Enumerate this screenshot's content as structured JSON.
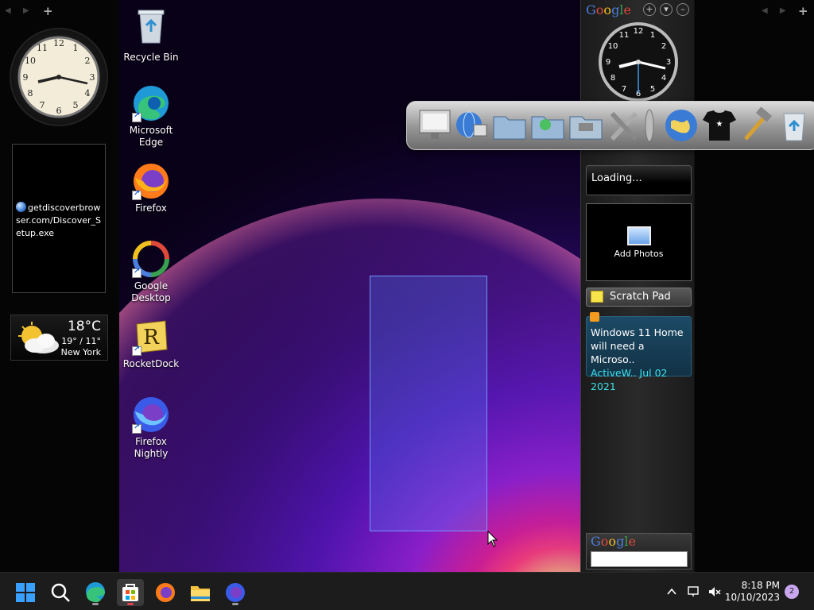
{
  "left_sidebar": {
    "nav_arrows": "◀ ▶",
    "add_label": "+",
    "download_file": "getdiscoverbrowser.com/Discover_Setup.exe",
    "weather": {
      "temperature": "18°C",
      "range": "19° / 11°",
      "city": "New York"
    }
  },
  "desktop": {
    "icons": [
      {
        "label": "Recycle Bin"
      },
      {
        "label": "Microsoft Edge"
      },
      {
        "label": "Firefox"
      },
      {
        "label": "Google Desktop"
      },
      {
        "label": "RocketDock"
      },
      {
        "label": "Firefox Nightly"
      }
    ]
  },
  "right_sidebar": {
    "google_logo": [
      "G",
      "o",
      "o",
      "g",
      "l",
      "e"
    ],
    "buttons": [
      "+",
      "▾",
      "–"
    ],
    "clock_numbers": [
      "12",
      "1",
      "2",
      "3",
      "4",
      "5",
      "6",
      "7",
      "8",
      "9",
      "10",
      "11"
    ],
    "loading_text": "Loading...",
    "photos_label": "Add Photos",
    "scratch_label": "Scratch Pad",
    "rss": {
      "title": "Windows 11 Home will need a Microso..",
      "meta": "ActiveW.. Jul 02 2021"
    }
  },
  "far_right": {
    "nav_arrows": "◀ ▶",
    "add_label": "+"
  },
  "dock": {
    "items": [
      "monitor-icon",
      "network-globe-icon",
      "folder-icon",
      "green-folder-icon",
      "drive-folder-icon",
      "tools-icon",
      "separator-icon",
      "globe-icon",
      "tshirt-icon",
      "hammer-icon",
      "recycle-bin-icon"
    ]
  },
  "taskbar": {
    "items": [
      "start-icon",
      "search-icon",
      "edge-icon",
      "store-icon",
      "firefox-icon",
      "file-explorer-icon",
      "firefox-nightly-icon"
    ],
    "time": "8:18 PM",
    "date": "10/10/2023",
    "notification_count": "2"
  },
  "colors": {
    "taskbar_bg": "#1c1c1c",
    "rss_meta": "#3fe0e8",
    "selection": "#5082ff"
  }
}
